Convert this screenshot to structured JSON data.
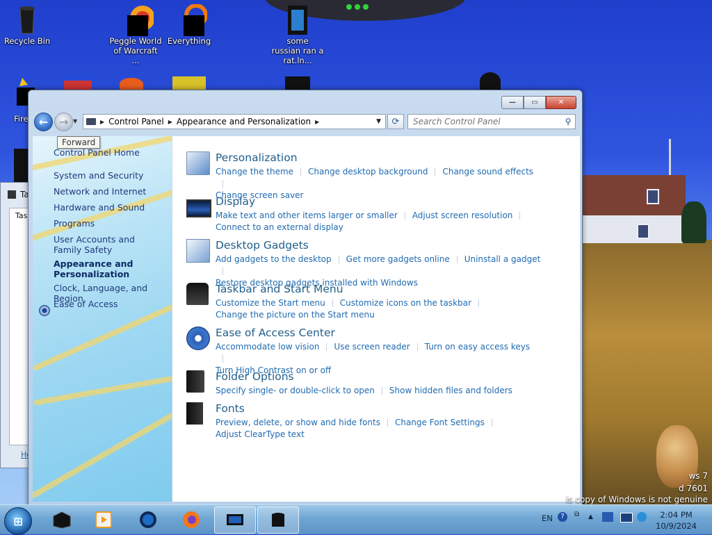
{
  "desktop": {
    "icons": [
      {
        "label": "Recycle Bin"
      },
      {
        "label": "Peggle World of Warcraft ..."
      },
      {
        "label": "Everything"
      },
      {
        "label": "some russian ran a rat.ln..."
      }
    ],
    "partial_icon_label": "Fire",
    "side_window_title": "Ta",
    "side_window_tab": "Tas",
    "side_window_link": "Ho"
  },
  "window": {
    "buttons": {
      "minimize": "—",
      "maximize": "▭",
      "close": "✕"
    },
    "address": {
      "segments": [
        "Control Panel",
        "Appearance and Personalization"
      ]
    },
    "search_placeholder": "Search Control Panel",
    "tooltip": "Forward",
    "left_nav": [
      "Control Panel Home",
      "System and Security",
      "Network and Internet",
      "Hardware and Sound",
      "Programs",
      "User Accounts and Family Safety",
      "Appearance and Personalization",
      "Clock, Language, and Region",
      "Ease of Access"
    ],
    "categories": [
      {
        "icon": "personalization-icon",
        "title": "Personalization",
        "links": [
          "Change the theme",
          "Change desktop background",
          "Change sound effects",
          "Change screen saver"
        ]
      },
      {
        "icon": "display-icon",
        "title": "Display",
        "links": [
          "Make text and other items larger or smaller",
          "Adjust screen resolution",
          "Connect to an external display"
        ]
      },
      {
        "icon": "desktop-gadgets-icon",
        "title": "Desktop Gadgets",
        "links": [
          "Add gadgets to the desktop",
          "Get more gadgets online",
          "Uninstall a gadget",
          "Restore desktop gadgets installed with Windows"
        ]
      },
      {
        "icon": "taskbar-icon",
        "title": "Taskbar and Start Menu",
        "links": [
          "Customize the Start menu",
          "Customize icons on the taskbar",
          "Change the picture on the Start menu"
        ]
      },
      {
        "icon": "ease-of-access-icon",
        "title": "Ease of Access Center",
        "links": [
          "Accommodate low vision",
          "Use screen reader",
          "Turn on easy access keys",
          "Turn High Contrast on or off"
        ]
      },
      {
        "icon": "folder-options-icon",
        "title": "Folder Options",
        "links": [
          "Specify single- or double-click to open",
          "Show hidden files and folders"
        ]
      },
      {
        "icon": "fonts-icon",
        "title": "Fonts",
        "links": [
          "Preview, delete, or show and hide fonts",
          "Change Font Settings",
          "Adjust ClearType text"
        ]
      }
    ]
  },
  "taskbar": {
    "language": "EN",
    "time": "2:04 PM",
    "date": "10/9/2024"
  },
  "watermark": {
    "line1": "ws 7",
    "line2": "d 7601",
    "line3": "is copy of Windows is not genuine"
  },
  "colors": {
    "link": "#1f6bb1",
    "category_title": "#1f5e8a",
    "nav_text": "#1f3a7a"
  }
}
